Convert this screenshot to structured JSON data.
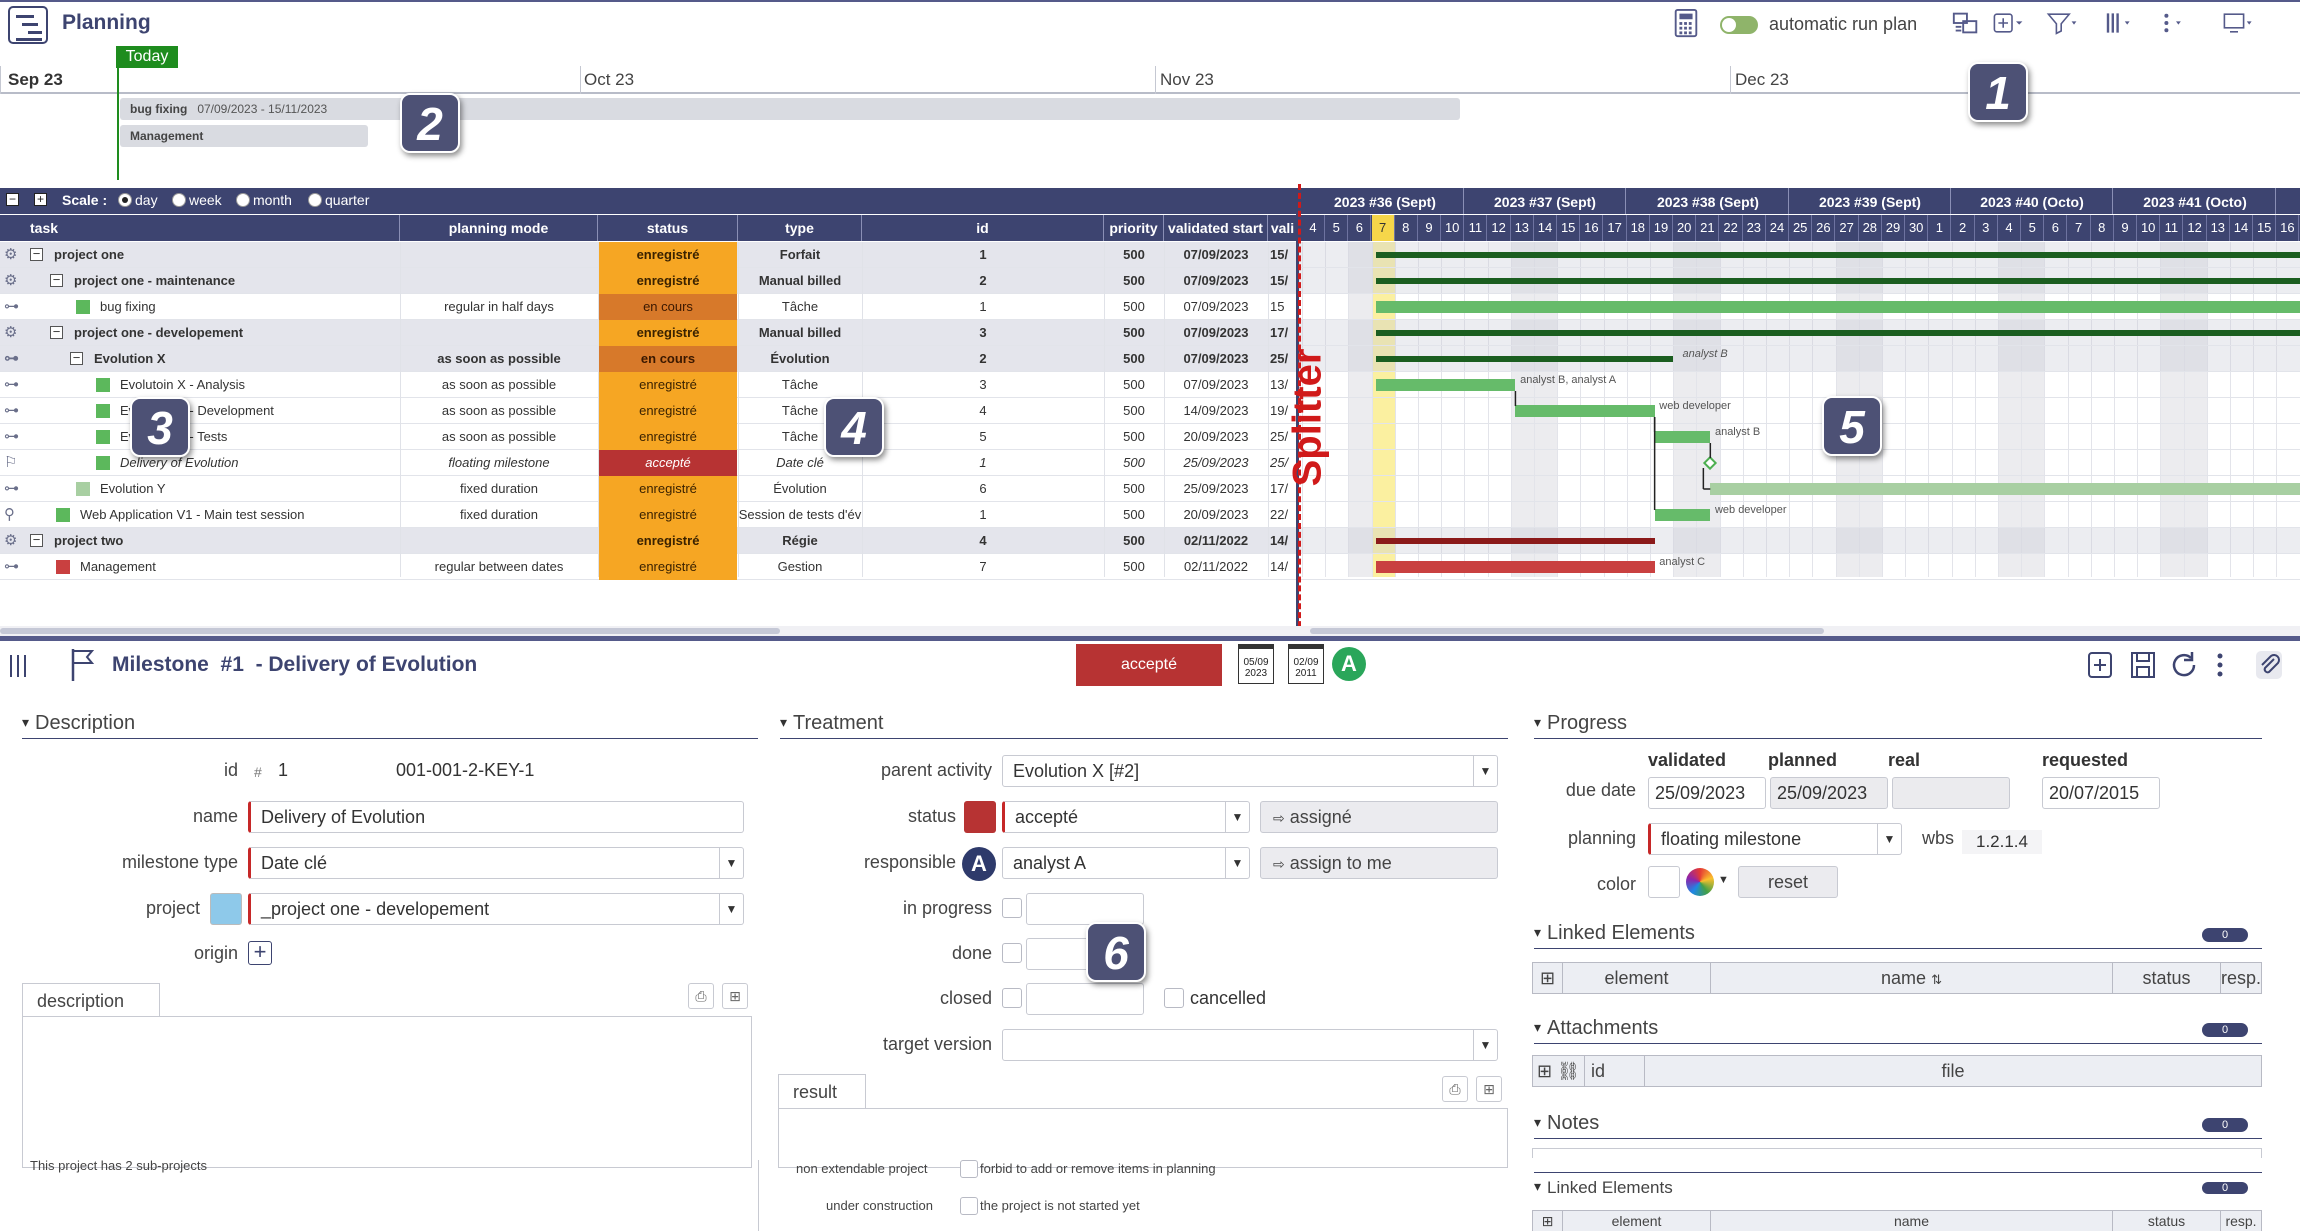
{
  "header": {
    "title": "Planning",
    "run_plan_label": "automatic run plan"
  },
  "timeline": {
    "today": "Today",
    "months": [
      "Sep 23",
      "Oct 23",
      "Nov 23",
      "Dec 23"
    ],
    "bars": [
      {
        "name": "bug fixing",
        "dates": "07/09/2023 - 15/11/2023"
      },
      {
        "name": "Management",
        "dates": ""
      }
    ]
  },
  "scale": {
    "label": "Scale :",
    "options": [
      "day",
      "week",
      "month",
      "quarter"
    ],
    "selected": "day"
  },
  "weeks": [
    "2023 #36 (Sept)",
    "2023 #37 (Sept)",
    "2023 #38 (Sept)",
    "2023 #39 (Sept)",
    "2023 #40 (Octo)",
    "2023 #41 (Octo)"
  ],
  "days": [
    "4",
    "5",
    "6",
    "7",
    "8",
    "9",
    "10",
    "11",
    "12",
    "13",
    "14",
    "15",
    "16",
    "17",
    "18",
    "19",
    "20",
    "21",
    "22",
    "23",
    "24",
    "25",
    "26",
    "27",
    "28",
    "29",
    "30",
    "1",
    "2",
    "3",
    "4",
    "5",
    "6",
    "7",
    "8",
    "9",
    "10",
    "11",
    "12",
    "13",
    "14",
    "15",
    "16"
  ],
  "columns": [
    "task",
    "planning mode",
    "status",
    "type",
    "id",
    "priority",
    "validated start",
    "vali"
  ],
  "rows": [
    {
      "task": "project one",
      "mode": "",
      "status": "enregistré",
      "type": "Forfait",
      "id": "1",
      "priority": "500",
      "start": "07/09/2023",
      "end": "15/"
    },
    {
      "task": "project one - maintenance",
      "mode": "",
      "status": "enregistré",
      "type": "Manual billed",
      "id": "2",
      "priority": "500",
      "start": "07/09/2023",
      "end": "15/"
    },
    {
      "task": "bug fixing",
      "mode": "regular in half days",
      "status": "en cours",
      "type": "Tâche",
      "id": "1",
      "priority": "500",
      "start": "07/09/2023",
      "end": "15"
    },
    {
      "task": "project one - developement",
      "mode": "",
      "status": "enregistré",
      "type": "Manual billed",
      "id": "3",
      "priority": "500",
      "start": "07/09/2023",
      "end": "17/"
    },
    {
      "task": "Evolution X",
      "mode": "as soon as possible",
      "status": "en cours",
      "type": "Évolution",
      "id": "2",
      "priority": "500",
      "start": "07/09/2023",
      "end": "25/"
    },
    {
      "task": "Evolutoin X - Analysis",
      "mode": "as soon as possible",
      "status": "enregistré",
      "type": "Tâche",
      "id": "3",
      "priority": "500",
      "start": "07/09/2023",
      "end": "13/"
    },
    {
      "task": "Evolution X - Development",
      "mode": "as soon as possible",
      "status": "enregistré",
      "type": "Tâche",
      "id": "4",
      "priority": "500",
      "start": "14/09/2023",
      "end": "19/"
    },
    {
      "task": "Evolution X - Tests",
      "mode": "as soon as possible",
      "status": "enregistré",
      "type": "Tâche",
      "id": "5",
      "priority": "500",
      "start": "20/09/2023",
      "end": "25/"
    },
    {
      "task": "Delivery of Evolution",
      "mode": "floating milestone",
      "status": "accepté",
      "type": "Date clé",
      "id": "1",
      "priority": "500",
      "start": "25/09/2023",
      "end": "25/"
    },
    {
      "task": "Evolution Y",
      "mode": "fixed duration",
      "status": "enregistré",
      "type": "Évolution",
      "id": "6",
      "priority": "500",
      "start": "25/09/2023",
      "end": "17/"
    },
    {
      "task": "Web Application V1 - Main test session",
      "mode": "fixed duration",
      "status": "enregistré",
      "type": "Session de tests d'év",
      "id": "1",
      "priority": "500",
      "start": "20/09/2023",
      "end": "22/"
    },
    {
      "task": "project two",
      "mode": "",
      "status": "enregistré",
      "type": "Régie",
      "id": "4",
      "priority": "500",
      "start": "02/11/2022",
      "end": "14/"
    },
    {
      "task": "Management",
      "mode": "regular between dates",
      "status": "enregistré",
      "type": "Gestion",
      "id": "7",
      "priority": "500",
      "start": "02/11/2022",
      "end": "14/"
    }
  ],
  "gantt_labels": {
    "analyst_b": "analyst B",
    "analyst_ba": "analyst B, analyst A",
    "web_dev": "web developer",
    "analyst_b2": "analyst B",
    "web_dev2": "web developer",
    "analyst_c": "analyst C"
  },
  "splitter": "Splitter",
  "detail": {
    "type": "Milestone",
    "number": "#1",
    "title": "- Delivery of Evolution",
    "status_button": "accepté",
    "cal1": [
      "05/09",
      "2023"
    ],
    "cal2": [
      "02/09",
      "2011"
    ],
    "avatar": "A"
  },
  "description": {
    "title": "Description",
    "id_label": "id",
    "id_hash": "#",
    "id_value": "1",
    "id_ref": "001-001-2-KEY-1",
    "name_label": "name",
    "name_value": "Delivery of Evolution",
    "type_label": "milestone type",
    "type_value": "Date clé",
    "project_label": "project",
    "project_value": "_project one - developement",
    "origin_label": "origin",
    "tab": "description",
    "footer_note": "This project has 2 sub-projects"
  },
  "treatment": {
    "title": "Treatment",
    "parent_label": "parent activity",
    "parent_value": "Evolution X [#2]",
    "status_label": "status",
    "status_value": "accepté",
    "assigned_btn": "assigné",
    "responsible_label": "responsible",
    "responsible_value": "analyst A",
    "assign_me_btn": "assign to me",
    "in_progress_label": "in progress",
    "done_label": "done",
    "closed_label": "closed",
    "cancelled_label": "cancelled",
    "target_label": "target version",
    "tab": "result",
    "non_ext_label": "non extendable project",
    "non_ext_text": "forbid to add or remove items in planning",
    "under_label": "under construction",
    "under_text": "the project is not started yet"
  },
  "progress": {
    "title": "Progress",
    "col_validated": "validated",
    "col_planned": "planned",
    "col_real": "real",
    "col_requested": "requested",
    "due_label": "due date",
    "due_validated": "25/09/2023",
    "due_planned": "25/09/2023",
    "due_requested": "20/07/2015",
    "planning_label": "planning",
    "planning_value": "floating milestone",
    "wbs_label": "wbs",
    "wbs_value": "1.2.1.4",
    "color_label": "color",
    "reset_btn": "reset"
  },
  "linked": {
    "title": "Linked Elements",
    "count": "0",
    "cols": [
      "element",
      "name",
      "status",
      "resp."
    ]
  },
  "attachments": {
    "title": "Attachments",
    "count": "0",
    "cols": [
      "id",
      "file"
    ]
  },
  "notes": {
    "title": "Notes",
    "count": "0"
  },
  "linked2": {
    "title": "Linked Elements",
    "count": "0",
    "cols": [
      "element",
      "name",
      "status",
      "resp."
    ]
  },
  "badges": [
    "1",
    "2",
    "3",
    "4",
    "5",
    "6"
  ],
  "colors": {
    "primary": "#3d4470",
    "status_registered": "#f6a623",
    "status_in_progress": "#d7792a",
    "status_accepted": "#b73333",
    "gantt_dark": "#1b5e20",
    "gantt_light": "#66bb6a",
    "gantt_red": "#8b1a1a"
  }
}
